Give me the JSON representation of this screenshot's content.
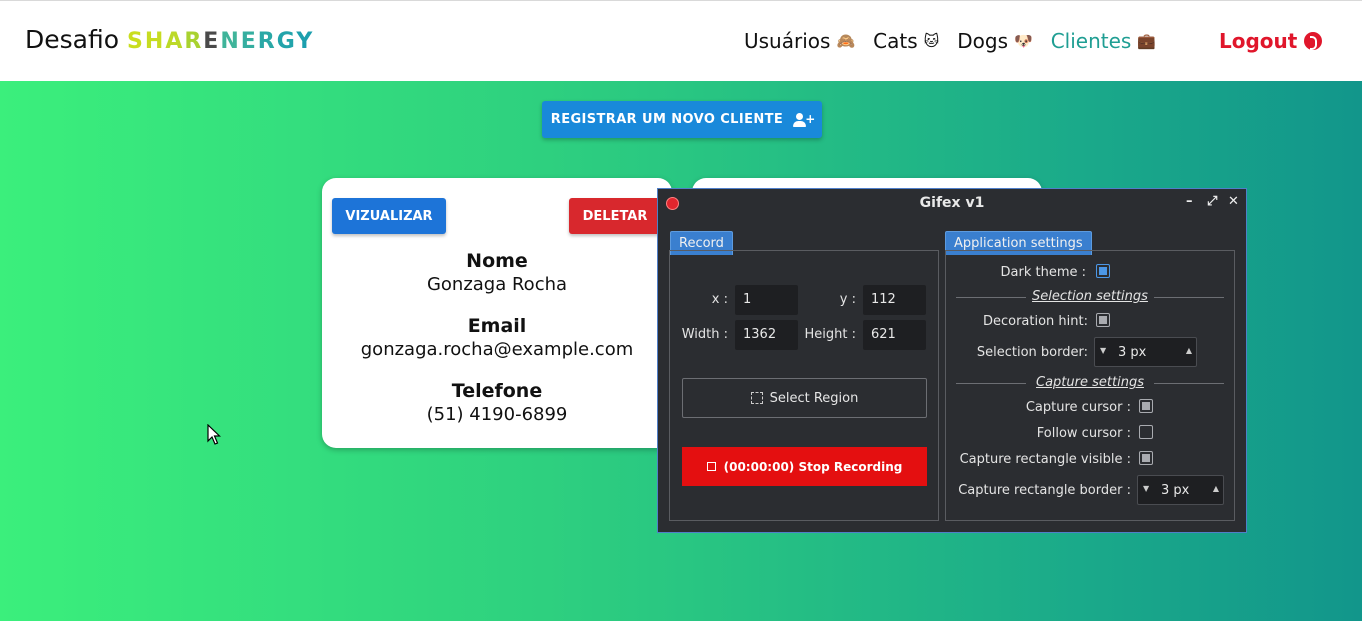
{
  "header": {
    "brand_prefix": "Desafio",
    "brand_name_letters": [
      "S",
      "H",
      "A",
      "R",
      "E",
      "N",
      "E",
      "R",
      "G",
      "Y"
    ],
    "brand_colors": [
      "#c9de1f",
      "#c7dc22",
      "#bcd928",
      "#a9d230",
      "#4a4a4a",
      "#3fb49a",
      "#35aea0",
      "#2aa8a6",
      "#22a4ab",
      "#1c9fae"
    ],
    "nav": [
      {
        "label": "Usuários",
        "emoji": "🙈"
      },
      {
        "label": "Cats",
        "emoji": "🐱"
      },
      {
        "label": "Dogs",
        "emoji": "🐶"
      },
      {
        "label": "Clientes",
        "emoji": "💼",
        "active": true
      }
    ],
    "logout_label": "Logout"
  },
  "main": {
    "register_label": "REGISTRAR UM NOVO CLIENTE",
    "card": {
      "view_label": "VIZUALIZAR",
      "delete_label": "DELETAR",
      "name_label": "Nome",
      "name_value": "Gonzaga Rocha",
      "email_label": "Email",
      "email_value": "gonzaga.rocha@example.com",
      "phone_label": "Telefone",
      "phone_value": "(51) 4190-6899"
    }
  },
  "gifex": {
    "title": "Gifex v1",
    "record_tab": "Record",
    "settings_tab": "Application settings",
    "x_label": "x :",
    "x_value": "1",
    "y_label": "y :",
    "y_value": "112",
    "width_label": "Width :",
    "width_value": "1362",
    "height_label": "Height :",
    "height_value": "621",
    "select_region_label": "Select Region",
    "stop_label": "(00:00:00) Stop Recording",
    "dark_theme_label": "Dark theme :",
    "dark_theme_checked": true,
    "selection_section": "Selection settings",
    "decoration_hint_label": "Decoration hint:",
    "decoration_hint_checked": true,
    "selection_border_label": "Selection border:",
    "selection_border_value": "3 px",
    "capture_section": "Capture settings",
    "capture_cursor_label": "Capture cursor :",
    "capture_cursor_checked": true,
    "follow_cursor_label": "Follow cursor :",
    "follow_cursor_checked": false,
    "capture_rect_visible_label": "Capture rectangle visible :",
    "capture_rect_visible_checked": true,
    "capture_rect_border_label": "Capture rectangle border :",
    "capture_rect_border_value": "3 px"
  }
}
